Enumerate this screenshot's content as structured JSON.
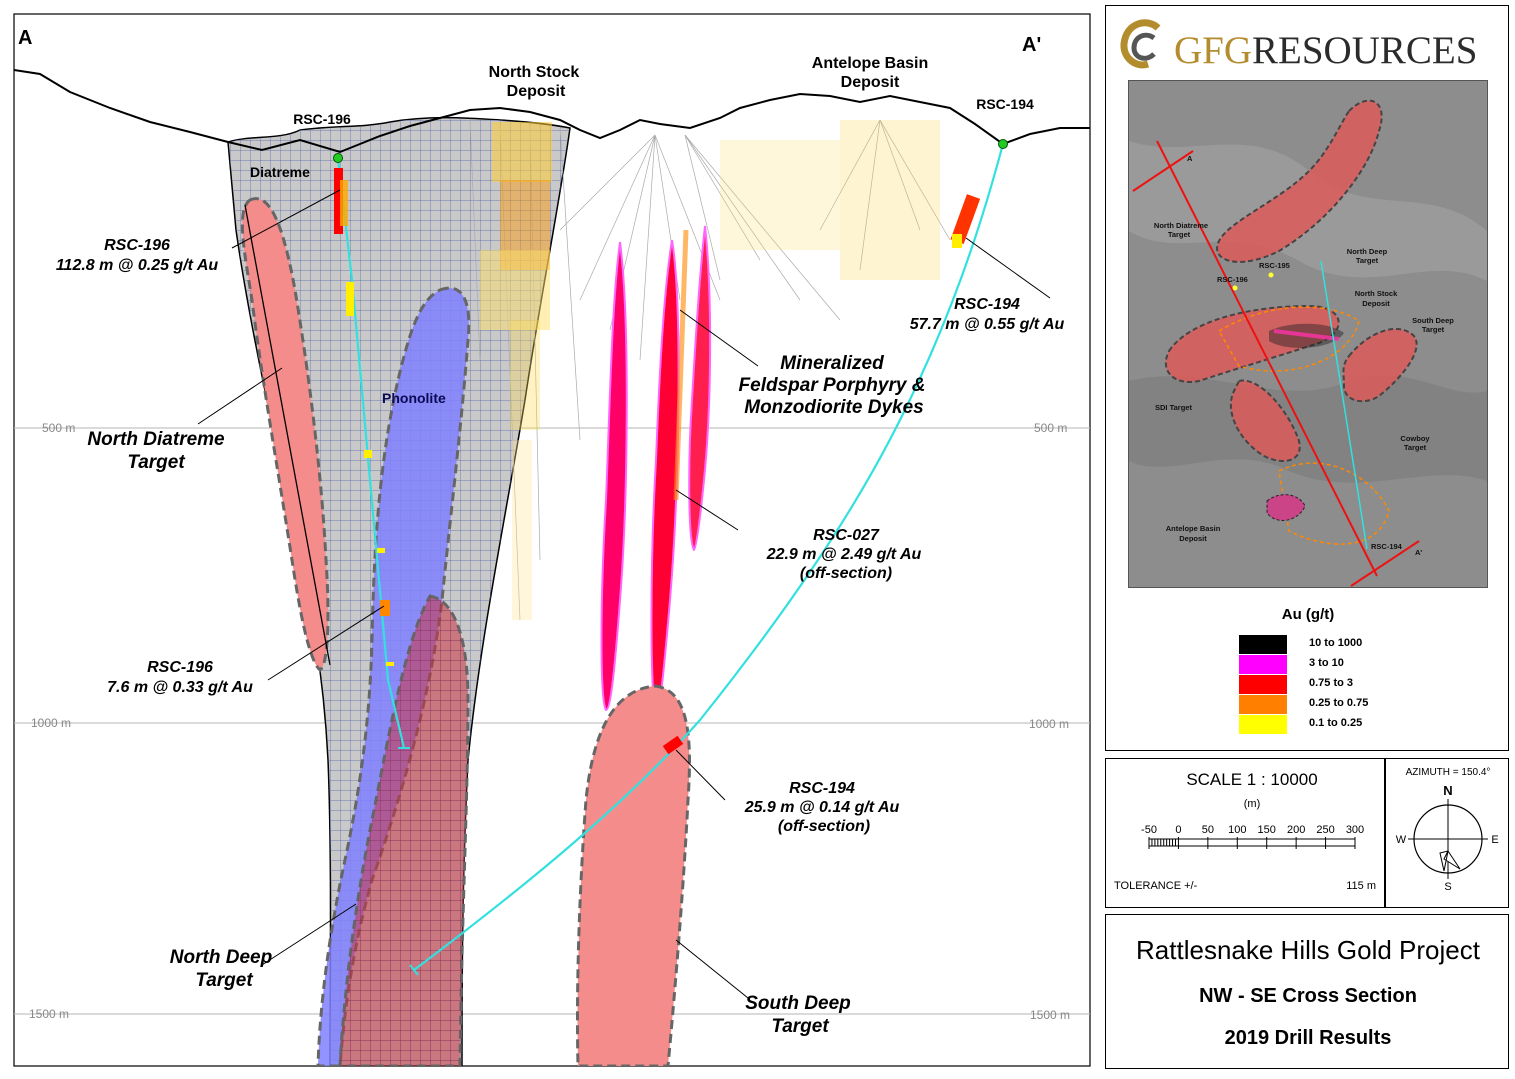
{
  "section": {
    "corner_left": "A",
    "corner_right": "A'",
    "deposits": {
      "north_stock": [
        "North Stock",
        "Deposit"
      ],
      "antelope": [
        "Antelope Basin",
        "Deposit"
      ]
    },
    "collars": {
      "rsc196": "RSC-196",
      "rsc194": "RSC-194"
    },
    "units": {
      "diatreme": "Diatreme",
      "phonolite": "Phonolite"
    },
    "elevations": {
      "e500": "500 m",
      "e1000": "1000 m",
      "e1500": "1500 m"
    },
    "intercepts": {
      "rsc196_a": [
        "RSC-196",
        "112.8 m @ 0.25 g/t Au"
      ],
      "rsc196_b": [
        "RSC-196",
        "7.6 m @ 0.33 g/t Au"
      ],
      "rsc194_a": [
        "RSC-194",
        "57.7 m @ 0.55 g/t Au"
      ],
      "rsc194_b": [
        "RSC-194",
        "25.9 m @ 0.14 g/t Au",
        "(off-section)"
      ],
      "rsc027": [
        "RSC-027",
        "22.9 m @ 2.49 g/t Au",
        "(off-section)"
      ]
    },
    "targets": {
      "north_diatreme": [
        "North Diatreme",
        "Target"
      ],
      "north_deep": [
        "North Deep",
        "Target"
      ],
      "south_deep": [
        "South Deep",
        "Target"
      ],
      "dykes": [
        "Mineralized",
        "Feldspar Porphyry &",
        "Monzodiorite Dykes"
      ]
    },
    "colors": {
      "diatreme_fill": "#c9c9c9",
      "phonolite_fill": "#8080ff",
      "target_fill": "#f58c8c",
      "trace": "#33e0e0",
      "collar": "#22cc22"
    }
  },
  "logo": {
    "gfg": "GFG",
    "resources": "RESOURCES"
  },
  "map": {
    "labels": {
      "north_diatreme": [
        "North Diatreme",
        "Target"
      ],
      "north_deep": [
        "North Deep",
        "Target"
      ],
      "north_stock": [
        "North Stock",
        "Deposit"
      ],
      "south_deep": [
        "South Deep",
        "Target"
      ],
      "sdi": "SDI Target",
      "cowboy": [
        "Cowboy",
        "Target"
      ],
      "antelope": [
        "Antelope Basin",
        "Deposit"
      ],
      "rsc196": "RSC-196",
      "rsc195": "RSC-195",
      "rsc194": "RSC-194",
      "a": "A",
      "a_prime": "A'"
    }
  },
  "legend": {
    "title": "Au (g/t)",
    "items": [
      {
        "label": "10 to 1000",
        "color": "#000000"
      },
      {
        "label": "3 to 10",
        "color": "#ff00ff"
      },
      {
        "label": "0.75 to 3",
        "color": "#ff0000"
      },
      {
        "label": "0.25 to 0.75",
        "color": "#ff8000"
      },
      {
        "label": "0.1 to 0.25",
        "color": "#ffff00"
      }
    ]
  },
  "scale": {
    "label": "SCALE  1 : 10000",
    "unit": "(m)",
    "ticks": [
      "-50",
      "0",
      "50",
      "100",
      "150",
      "200",
      "250",
      "300"
    ],
    "tolerance_label": "TOLERANCE  +/-",
    "tolerance_value": "115 m"
  },
  "north_arrow": {
    "azimuth": "AZIMUTH = 150.4°",
    "n": "N",
    "s": "S",
    "e": "E",
    "w": "W"
  },
  "title": {
    "main": "Rattlesnake Hills Gold Project",
    "sub": "NW - SE Cross Section",
    "year": "2019 Drill Results"
  }
}
